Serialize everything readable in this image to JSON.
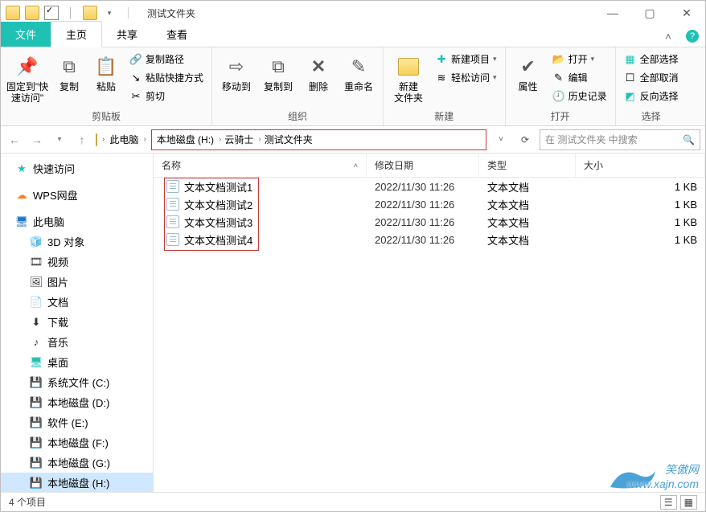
{
  "titlebar": {
    "title": "测试文件夹"
  },
  "tabs": {
    "file": "文件",
    "home": "主页",
    "share": "共享",
    "view": "查看"
  },
  "ribbon": {
    "clipboard": {
      "label": "剪贴板",
      "pin": "固定到\"快\n速访问\"",
      "copy": "复制",
      "paste": "粘贴",
      "copy_path": "复制路径",
      "paste_shortcut": "粘贴快捷方式",
      "cut": "剪切"
    },
    "organize": {
      "label": "组织",
      "move_to": "移动到",
      "copy_to": "复制到",
      "delete": "删除",
      "rename": "重命名"
    },
    "new": {
      "label": "新建",
      "new_folder": "新建\n文件夹",
      "new_item": "新建项目",
      "easy_access": "轻松访问"
    },
    "open": {
      "label": "打开",
      "properties": "属性",
      "open": "打开",
      "edit": "编辑",
      "history": "历史记录"
    },
    "select": {
      "label": "选择",
      "select_all": "全部选择",
      "select_none": "全部取消",
      "invert": "反向选择"
    }
  },
  "breadcrumb": {
    "root": "此电脑",
    "p1": "本地磁盘 (H:)",
    "p2": "云骑士",
    "p3": "测试文件夹"
  },
  "search": {
    "placeholder": "在 测试文件夹 中搜索"
  },
  "sidebar": {
    "quick_access": "快速访问",
    "wps": "WPS网盘",
    "this_pc": "此电脑",
    "items": [
      {
        "label": "3D 对象",
        "color": "#1fc1b4"
      },
      {
        "label": "视频",
        "color": "#333"
      },
      {
        "label": "图片",
        "color": "#333"
      },
      {
        "label": "文档",
        "color": "#333"
      },
      {
        "label": "下载",
        "color": "#333"
      },
      {
        "label": "音乐",
        "color": "#333"
      },
      {
        "label": "桌面",
        "color": "#1fc1b4"
      },
      {
        "label": "系统文件 (C:)",
        "color": "#333"
      },
      {
        "label": "本地磁盘 (D:)",
        "color": "#333"
      },
      {
        "label": "软件 (E:)",
        "color": "#333"
      },
      {
        "label": "本地磁盘 (F:)",
        "color": "#333"
      },
      {
        "label": "本地磁盘 (G:)",
        "color": "#333"
      },
      {
        "label": "本地磁盘 (H:)",
        "color": "#333"
      }
    ]
  },
  "columns": {
    "name": "名称",
    "date": "修改日期",
    "type": "类型",
    "size": "大小"
  },
  "files": [
    {
      "name": "文本文档测试1",
      "date": "2022/11/30 11:26",
      "type": "文本文档",
      "size": "1 KB"
    },
    {
      "name": "文本文档测试2",
      "date": "2022/11/30 11:26",
      "type": "文本文档",
      "size": "1 KB"
    },
    {
      "name": "文本文档测试3",
      "date": "2022/11/30 11:26",
      "type": "文本文档",
      "size": "1 KB"
    },
    {
      "name": "文本文档测试4",
      "date": "2022/11/30 11:26",
      "type": "文本文档",
      "size": "1 KB"
    }
  ],
  "status": {
    "text": "4 个项目"
  },
  "watermark": "笑傲网\nwww.xajn.com"
}
